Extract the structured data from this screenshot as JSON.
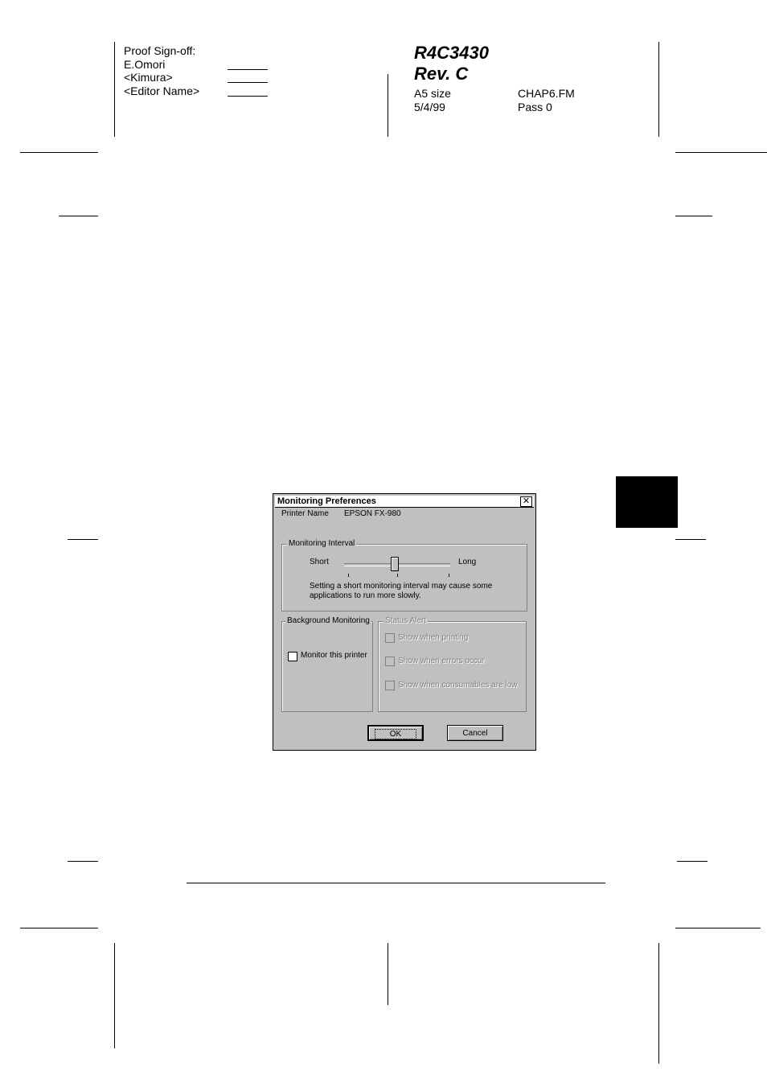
{
  "header": {
    "signoff_title": "Proof Sign-off:",
    "signoff_names": [
      "E.Omori",
      "<Kimura>",
      "<Editor Name>"
    ],
    "doc_code": "R4C3430",
    "revision": "Rev. C",
    "paper_size": "A5 size",
    "date": "5/4/99",
    "file_name": "CHAP6.FM",
    "pass": "Pass 0"
  },
  "dialog": {
    "title": "Monitoring Preferences",
    "close_glyph": "✕",
    "printer_name_label": "Printer Name",
    "printer_name_value": "EPSON FX-980",
    "monitoring_interval": {
      "group_title": "Monitoring Interval",
      "short_label": "Short",
      "long_label": "Long",
      "slider_position_fraction": 0.47,
      "note_line1": "Setting a short monitoring interval may cause some",
      "note_line2": "applications to run more slowly."
    },
    "background_monitoring": {
      "group_title": "Background Monitoring",
      "monitor_label": "Monitor this printer",
      "monitor_checked": false
    },
    "status_alert": {
      "group_title": "Status Alert",
      "options": [
        "Show when printing",
        "Show when errors occur",
        "Show when consumables are low"
      ]
    },
    "ok_label": "OK",
    "cancel_label": "Cancel"
  }
}
